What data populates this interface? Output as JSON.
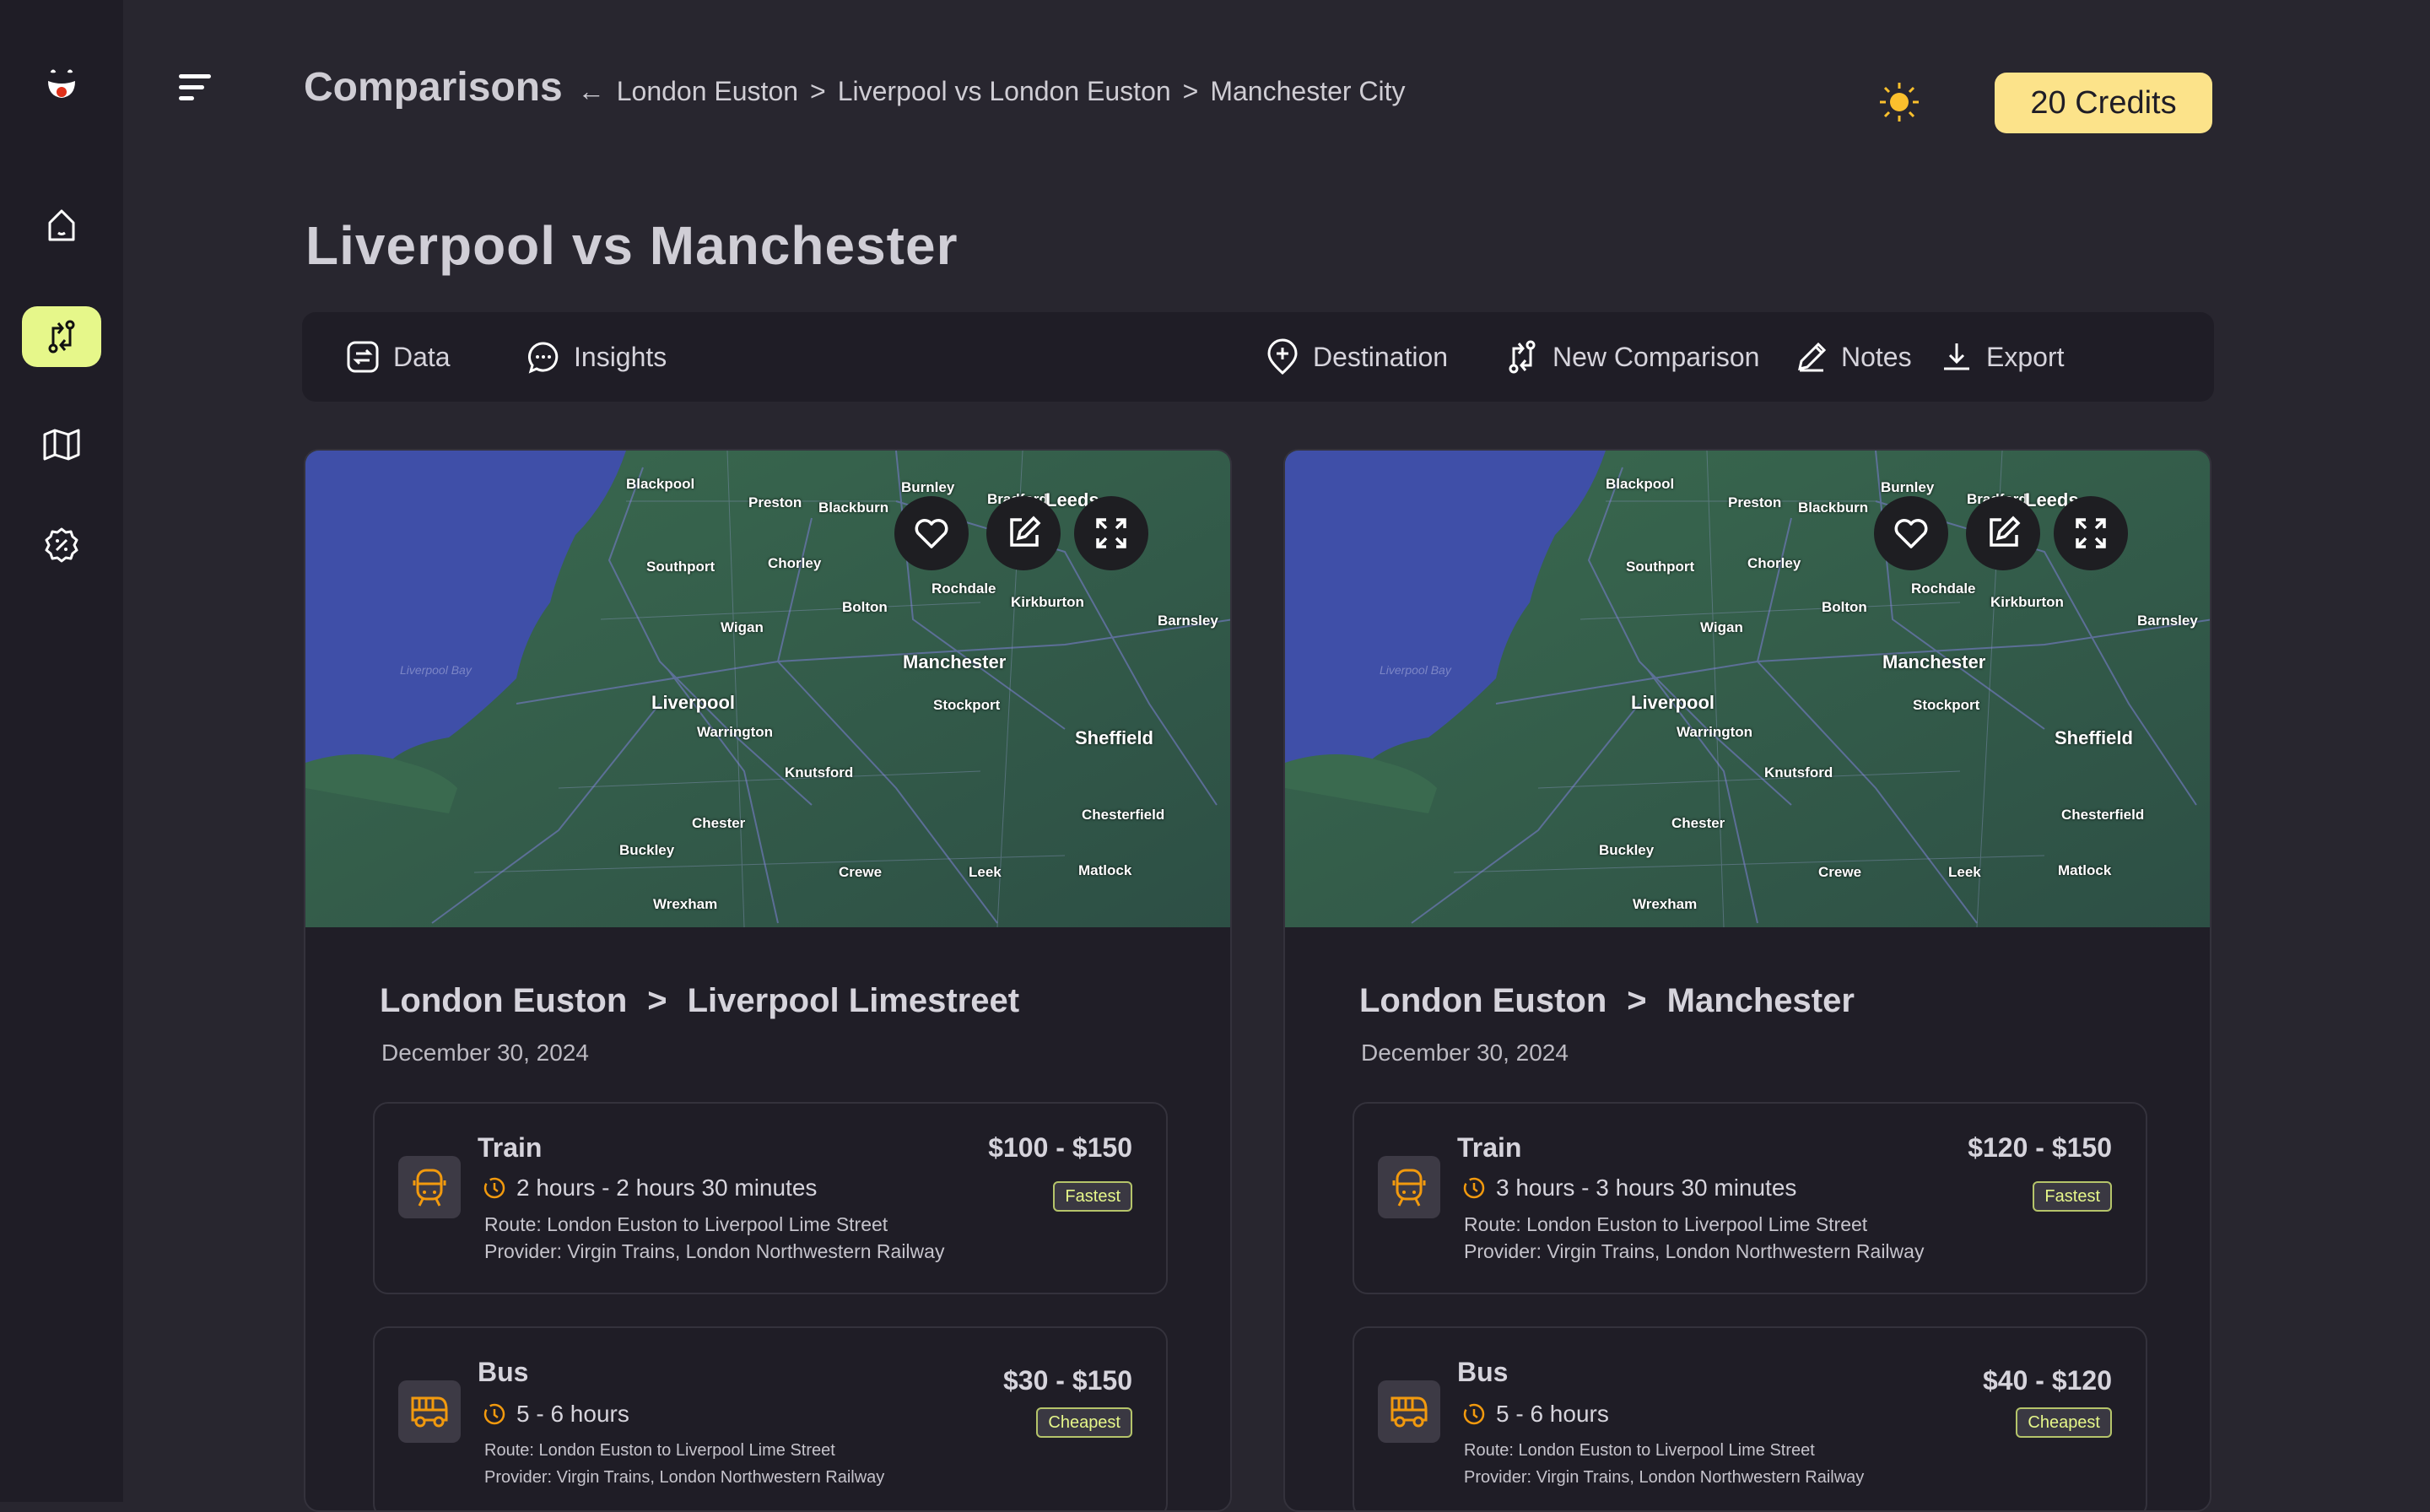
{
  "sidebar": {
    "items": [
      {
        "icon": "logo-icon"
      },
      {
        "icon": "home-icon"
      },
      {
        "icon": "compare-icon",
        "active": true
      },
      {
        "icon": "map-icon"
      },
      {
        "icon": "discount-icon"
      }
    ]
  },
  "header": {
    "title": "Comparisons",
    "breadcrumb": [
      "London Euston",
      "Liverpool vs London Euston",
      "Manchester City"
    ],
    "separator": ">",
    "credits": "20 Credits"
  },
  "page_title": "Liverpool vs Manchester",
  "toolbar": {
    "data": "Data",
    "insights": "Insights",
    "destination": "Destination",
    "new_comparison": "New Comparison",
    "notes": "Notes",
    "export": "Export"
  },
  "map_labels": [
    {
      "t": "Blackpool",
      "big": false
    },
    {
      "t": "Preston",
      "big": false
    },
    {
      "t": "Blackburn",
      "big": false
    },
    {
      "t": "Burnley",
      "big": false
    },
    {
      "t": "Bradford",
      "big": false
    },
    {
      "t": "Leeds",
      "big": true
    },
    {
      "t": "Southport",
      "big": false
    },
    {
      "t": "Chorley",
      "big": false
    },
    {
      "t": "Bolton",
      "big": false
    },
    {
      "t": "Rochdale",
      "big": false
    },
    {
      "t": "Kirkburton",
      "big": false
    },
    {
      "t": "Barnsley",
      "big": false
    },
    {
      "t": "Wigan",
      "big": false
    },
    {
      "t": "Manchester",
      "big": true
    },
    {
      "t": "Liverpool",
      "big": true
    },
    {
      "t": "Stockport",
      "big": false
    },
    {
      "t": "Warrington",
      "big": false
    },
    {
      "t": "Sheffield",
      "big": true
    },
    {
      "t": "Knutsford",
      "big": false
    },
    {
      "t": "Chester",
      "big": false
    },
    {
      "t": "Chesterfield",
      "big": false
    },
    {
      "t": "Buckley",
      "big": false
    },
    {
      "t": "Crewe",
      "big": false
    },
    {
      "t": "Leek",
      "big": false
    },
    {
      "t": "Matlock",
      "big": false
    },
    {
      "t": "Wrexham",
      "big": false
    },
    {
      "t": "Liverpool Bay",
      "big": false
    }
  ],
  "comparisons": [
    {
      "from": "London Euston",
      "to": "Liverpool Limestreet",
      "date": "December 30, 2024",
      "options": [
        {
          "mode": "Train",
          "icon": "train-icon",
          "duration": "2 hours - 2 hours 30 minutes",
          "route": "Route: London Euston to Liverpool Lime Street",
          "provider": "Provider: Virgin Trains, London Northwestern Railway",
          "price": "$100 - $150",
          "badge": "Fastest"
        },
        {
          "mode": "Bus",
          "icon": "bus-icon",
          "duration": "5 - 6 hours",
          "route": "Route: London Euston to Liverpool Lime Street",
          "provider": "Provider: Virgin Trains, London Northwestern Railway",
          "price": "$30 - $150",
          "badge": "Cheapest"
        }
      ]
    },
    {
      "from": "London Euston",
      "to": "Manchester",
      "date": "December 30, 2024",
      "options": [
        {
          "mode": "Train",
          "icon": "train-icon",
          "duration": "3 hours - 3 hours 30 minutes",
          "route": "Route: London Euston to Liverpool Lime Street",
          "provider": "Provider: Virgin Trains, London Northwestern Railway",
          "price": "$120 - $150",
          "badge": "Fastest"
        },
        {
          "mode": "Bus",
          "icon": "bus-icon",
          "duration": "5 - 6 hours",
          "route": "Route: London Euston to Liverpool Lime Street",
          "provider": "Provider: Virgin Trains, London Northwestern Railway",
          "price": "$40 - $120",
          "badge": "Cheapest"
        }
      ]
    }
  ],
  "colors": {
    "accent": "#e6f78a",
    "credits": "#fce38a",
    "icon_orange": "#f29a0e",
    "bg": "#28262f",
    "sidebar": "#1f1d26"
  }
}
